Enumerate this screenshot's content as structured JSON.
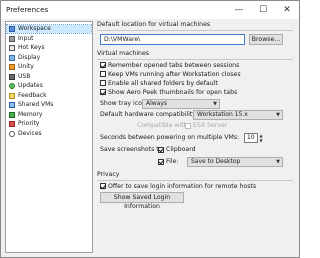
{
  "window": {
    "title": "Preferences",
    "min_glyph": "—",
    "max_glyph": "☐",
    "close_glyph": "✕"
  },
  "sidebar": {
    "items": [
      {
        "label": "Workspace",
        "icon": "workspace-icon",
        "selected": true
      },
      {
        "label": "Input",
        "icon": "input-icon"
      },
      {
        "label": "Hot Keys",
        "icon": "hot-keys-icon"
      },
      {
        "label": "Display",
        "icon": "display-icon"
      },
      {
        "label": "Unity",
        "icon": "unity-icon"
      },
      {
        "label": "USB",
        "icon": "usb-icon"
      },
      {
        "label": "Updates",
        "icon": "updates-icon"
      },
      {
        "label": "Feedback",
        "icon": "feedback-icon"
      },
      {
        "label": "Shared VMs",
        "icon": "shared-vms-icon"
      },
      {
        "label": "Memory",
        "icon": "memory-icon"
      },
      {
        "label": "Priority",
        "icon": "priority-icon"
      },
      {
        "label": "Devices",
        "icon": "devices-icon"
      }
    ]
  },
  "default_location": {
    "label": "Default location for virtual machines",
    "value": "D:\\VMWare\\",
    "browse_label": "Browse..."
  },
  "virtual_machines": {
    "title": "Virtual machines",
    "checks": [
      {
        "label": "Remember opened tabs between sessions",
        "checked": true
      },
      {
        "label": "Keep VMs running after Workstation closes",
        "checked": false
      },
      {
        "label": "Enable all shared folders by default",
        "checked": false
      },
      {
        "label": "Show Aero Peek thumbnails for open tabs",
        "checked": true
      }
    ],
    "show_tray_icon_label": "Show tray icon:",
    "show_tray_icon_value": "Always",
    "hw_compat_label": "Default hardware compatibility:",
    "hw_compat_value": "Workstation 15.x",
    "compatible_with_label": "Compatible with:",
    "esx_server_label": "ESX Server",
    "seconds_label": "Seconds between powering on multiple VMs:",
    "seconds_value": "10",
    "save_screenshots_label": "Save screenshots to:",
    "clipboard_label": "Clipboard",
    "clipboard_checked": true,
    "file_label": "File:",
    "file_checked": true,
    "file_value": "Save to Desktop"
  },
  "privacy": {
    "title": "Privacy",
    "offer_label": "Offer to save login information for remote hosts",
    "offer_checked": true,
    "show_saved_label": "Show Saved Login Information"
  }
}
